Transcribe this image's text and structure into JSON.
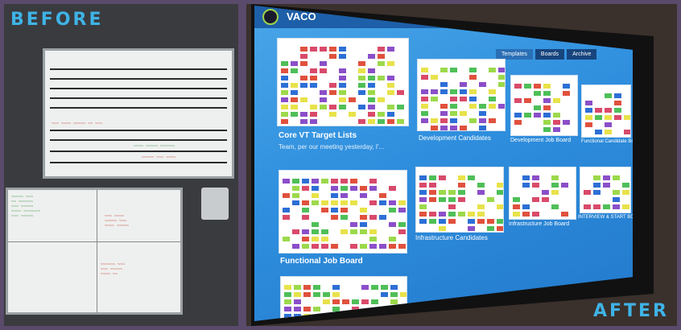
{
  "labels": {
    "before": "BEFORE",
    "after": "AFTER"
  },
  "screen": {
    "app_title": "VACO",
    "tabs": [
      {
        "label": "Templates",
        "active": true
      },
      {
        "label": "Boards",
        "active": false
      },
      {
        "label": "Archive",
        "active": false
      }
    ],
    "boards": [
      {
        "name": "Core VT Target Lists",
        "subtitle": "Team, per our meeting yesterday, I'..."
      },
      {
        "name": "Development Candidates"
      },
      {
        "name": "Development Job Board"
      },
      {
        "name": "Functional Candidate Board"
      },
      {
        "name": "Functional Job Board"
      },
      {
        "name": "Infrastructure Candidates"
      },
      {
        "name": "Infrastructure Job Board"
      },
      {
        "name": "INTERVIEW & START BOARD"
      }
    ]
  },
  "colors": {
    "label_blue": "#3fb3e6",
    "card_palette": [
      "#e8e24a",
      "#e0513d",
      "#4fbf58",
      "#2d6fd6",
      "#8b4fc9",
      "#9cd94b",
      "#d94a6a"
    ]
  }
}
